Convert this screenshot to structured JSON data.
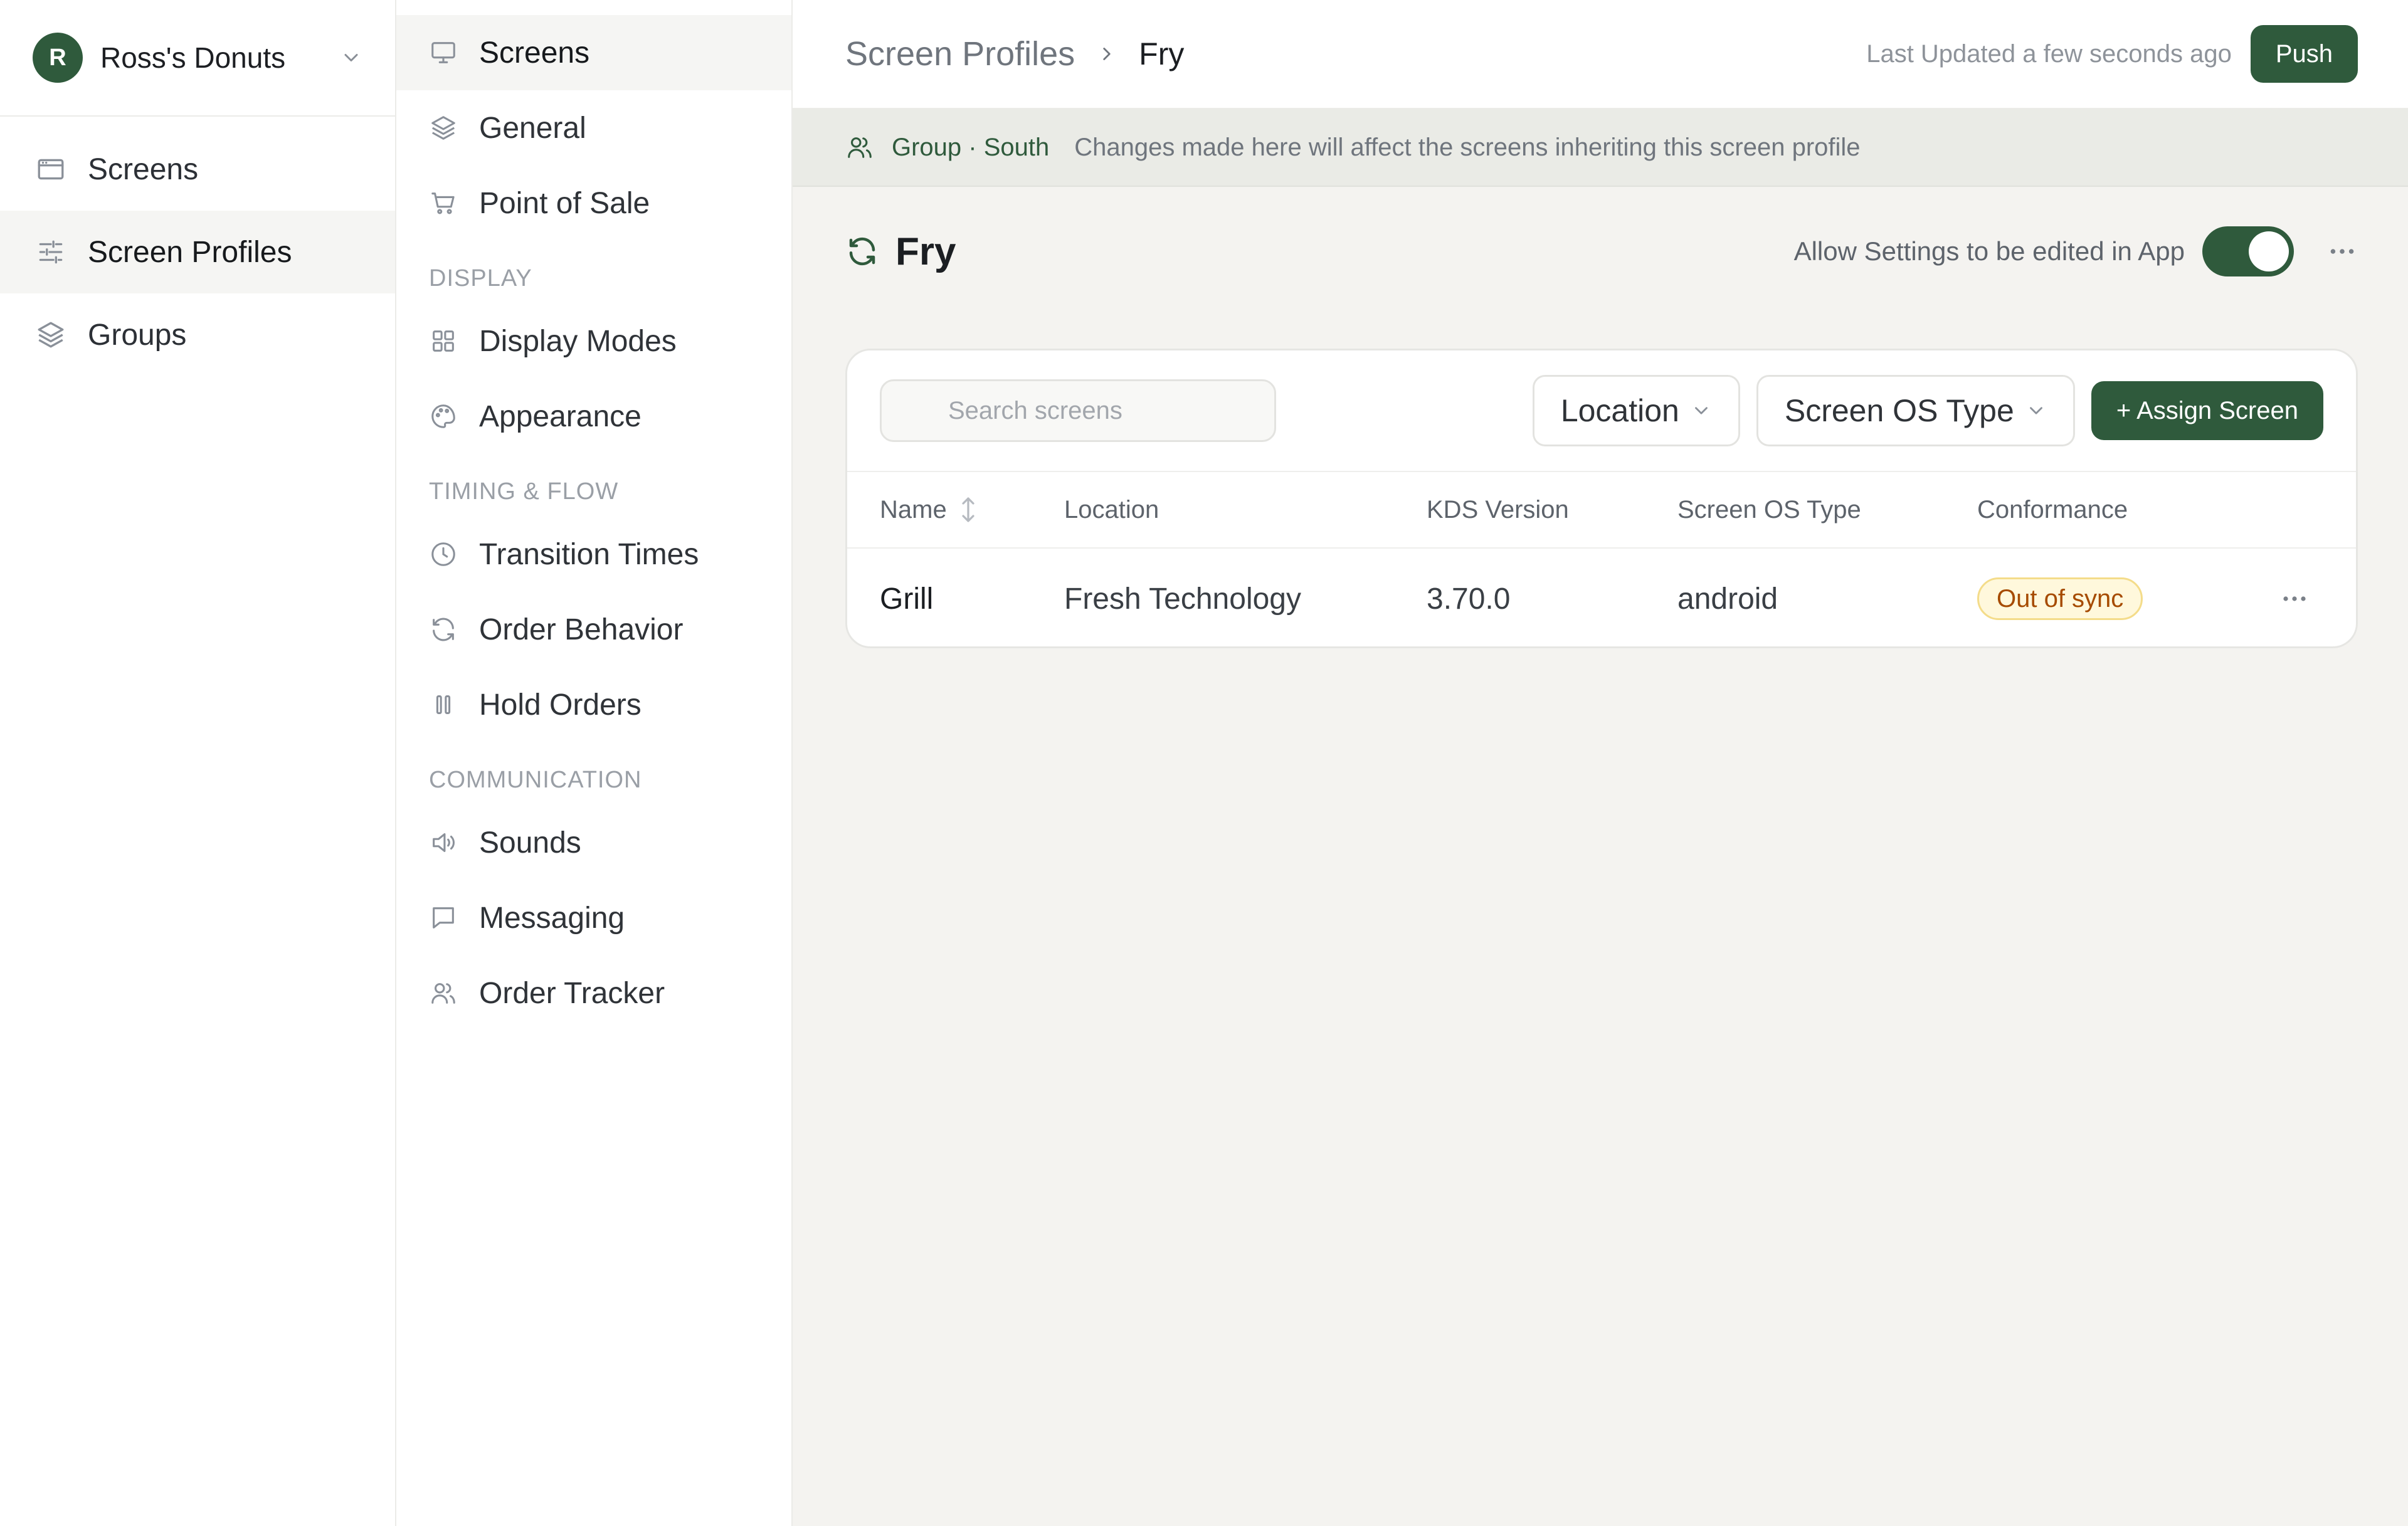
{
  "org": {
    "initial": "R",
    "name": "Ross's Donuts"
  },
  "nav": {
    "items": [
      {
        "label": "Screens",
        "icon": "browser-window-icon"
      },
      {
        "label": "Screen Profiles",
        "icon": "sliders-icon",
        "active": true
      },
      {
        "label": "Groups",
        "icon": "layers-icon"
      }
    ]
  },
  "settings_nav": {
    "top": [
      {
        "label": "Screens",
        "icon": "monitor-icon",
        "active": true
      },
      {
        "label": "General",
        "icon": "layers-icon"
      },
      {
        "label": "Point of Sale",
        "icon": "cart-icon"
      }
    ],
    "sections": [
      {
        "title": "DISPLAY",
        "items": [
          {
            "label": "Display Modes",
            "icon": "grid-icon"
          },
          {
            "label": "Appearance",
            "icon": "palette-icon"
          }
        ]
      },
      {
        "title": "TIMING & FLOW",
        "items": [
          {
            "label": "Transition Times",
            "icon": "clock-icon"
          },
          {
            "label": "Order Behavior",
            "icon": "refresh-icon"
          },
          {
            "label": "Hold Orders",
            "icon": "pause-icon"
          }
        ]
      },
      {
        "title": "COMMUNICATION",
        "items": [
          {
            "label": "Sounds",
            "icon": "speaker-icon"
          },
          {
            "label": "Messaging",
            "icon": "message-icon"
          },
          {
            "label": "Order Tracker",
            "icon": "users-icon"
          }
        ]
      }
    ]
  },
  "header": {
    "breadcrumb_root": "Screen Profiles",
    "breadcrumb_current": "Fry",
    "last_updated": "Last Updated a few seconds ago",
    "push_label": "Push"
  },
  "banner": {
    "group": "Group · South",
    "message": "Changes made here will affect the screens inheriting this screen profile"
  },
  "profile": {
    "title": "Fry",
    "allow_edit_label": "Allow Settings to be edited in App",
    "allow_edit_enabled": true
  },
  "screens_table": {
    "search_placeholder": "Search screens",
    "filter_location": "Location",
    "filter_os": "Screen OS Type",
    "assign_label": "+ Assign Screen",
    "columns": [
      "Name",
      "Location",
      "KDS Version",
      "Screen OS Type",
      "Conformance"
    ],
    "rows": [
      {
        "name": "Grill",
        "location": "Fresh Technology",
        "kds_version": "3.70.0",
        "os_type": "android",
        "conformance": "Out of sync"
      }
    ]
  },
  "colors": {
    "brand": "#2f5a3c",
    "badge_text": "#a64b00",
    "badge_bg": "#fff8dc"
  }
}
